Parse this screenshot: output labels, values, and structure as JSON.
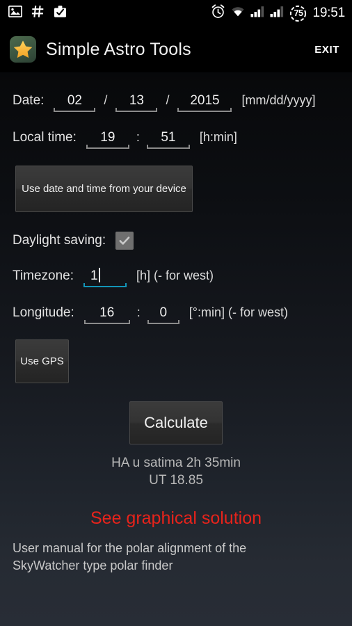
{
  "statusbar": {
    "left_icons": [
      "image-icon",
      "hash-icon",
      "briefcase-check-icon"
    ],
    "right_icons": [
      "alarm-icon",
      "wifi-icon",
      "signal-icon-1",
      "signal-icon-2"
    ],
    "battery_level": "75",
    "clock": "19:51"
  },
  "titlebar": {
    "app_icon": "star-icon",
    "title": "Simple Astro Tools",
    "exit_label": "EXIT"
  },
  "form": {
    "date": {
      "label": "Date:",
      "month": "02",
      "day": "13",
      "year": "2015",
      "separator": "/",
      "format_hint": "[mm/dd/yyyy]"
    },
    "local_time": {
      "label": "Local time:",
      "hour": "19",
      "minute": "51",
      "separator": ":",
      "format_hint": "[h:min]"
    },
    "device_button_label": "Use date and time from your device",
    "daylight_saving": {
      "label": "Daylight saving:",
      "checked": true,
      "check_icon": "checkmark-icon"
    },
    "timezone": {
      "label": "Timezone:",
      "value": "1",
      "focused": true,
      "format_hint": "[h] (- for west)"
    },
    "longitude": {
      "label": "Longitude:",
      "degrees": "16",
      "minutes": "0",
      "separator": ":",
      "format_hint": "[°:min] (- for west)"
    },
    "gps_button_label": "Use GPS",
    "calculate_button_label": "Calculate"
  },
  "results": {
    "line1": "HA u satima 2h 35min",
    "line2": "UT 18.85"
  },
  "links": {
    "graphical_solution": "See graphical solution",
    "manual_line1": "User manual for the polar alignment of the",
    "manual_line2": "SkyWatcher type polar finder"
  },
  "colors": {
    "focus_accent": "#1295b8",
    "link_red": "#e7231b",
    "status_bar_bg": "#000000",
    "page_bg_bottom": "#262b33"
  }
}
